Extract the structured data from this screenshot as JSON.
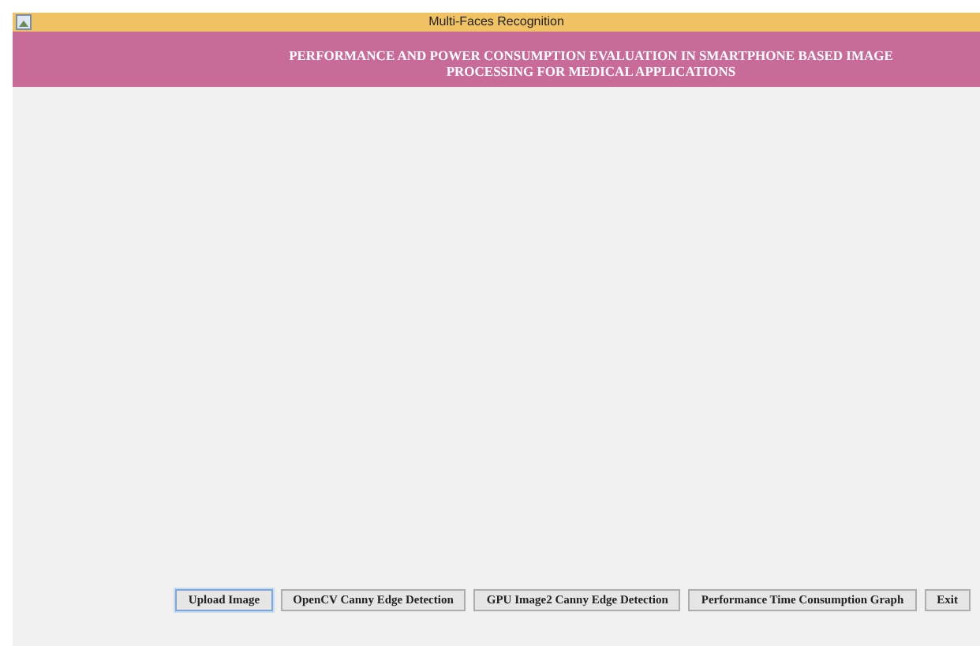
{
  "window": {
    "title": "Multi-Faces Recognition"
  },
  "banner": {
    "lines": [
      "PERFORMANCE AND POWER CONSUMPTION EVALUATION IN SMARTPHONE BASED IMAGE",
      "PROCESSING FOR MEDICAL APPLICATIONS"
    ]
  },
  "buttons": [
    {
      "label": "Upload Image",
      "selected": true
    },
    {
      "label": "OpenCV Canny Edge Detection",
      "selected": false
    },
    {
      "label": "GPU Image2 Canny Edge Detection",
      "selected": false
    },
    {
      "label": "Performance Time Consumption Graph",
      "selected": false
    },
    {
      "label": "Exit",
      "selected": false
    }
  ]
}
